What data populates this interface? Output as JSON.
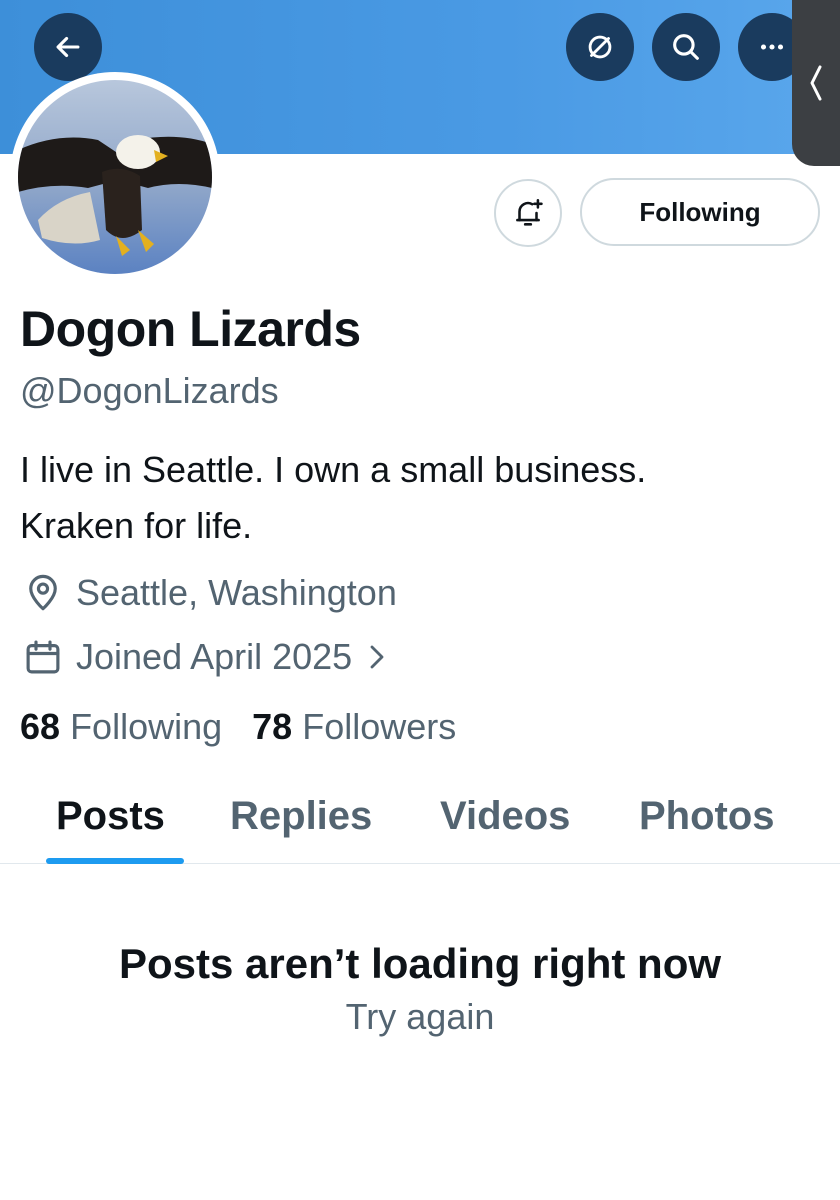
{
  "header": {
    "back_icon": "arrow-left-icon",
    "grok_icon": "grok-slash-icon",
    "search_icon": "search-icon",
    "more_icon": "more-horizontal-icon",
    "edge_icon": "chevron-left-icon"
  },
  "profile": {
    "avatar_icon": "bald-eagle-avatar",
    "notify_icon": "bell-plus-icon",
    "follow_label": "Following",
    "display_name": "Dogon Lizards",
    "handle": "@DogonLizards",
    "bio_line1": "I live in Seattle. I own a small business.",
    "bio_line2": "Kraken for life.",
    "location_icon": "location-pin-icon",
    "location": "Seattle, Washington",
    "joined_icon": "calendar-icon",
    "joined": "Joined April 2025",
    "following_count": "68",
    "following_label": "Following",
    "followers_count": "78",
    "followers_label": "Followers"
  },
  "tabs": [
    {
      "label": "Posts",
      "active": true
    },
    {
      "label": "Replies",
      "active": false
    },
    {
      "label": "Videos",
      "active": false
    },
    {
      "label": "Photos",
      "active": false
    }
  ],
  "feed": {
    "error_message": "Posts aren’t loading right now",
    "retry_label": "Try again"
  },
  "colors": {
    "banner": "#4a9ae4",
    "header_button": "#1a3b5e",
    "accent": "#1d9bf0",
    "secondary_text": "#536471",
    "primary_text": "#0f1419"
  }
}
